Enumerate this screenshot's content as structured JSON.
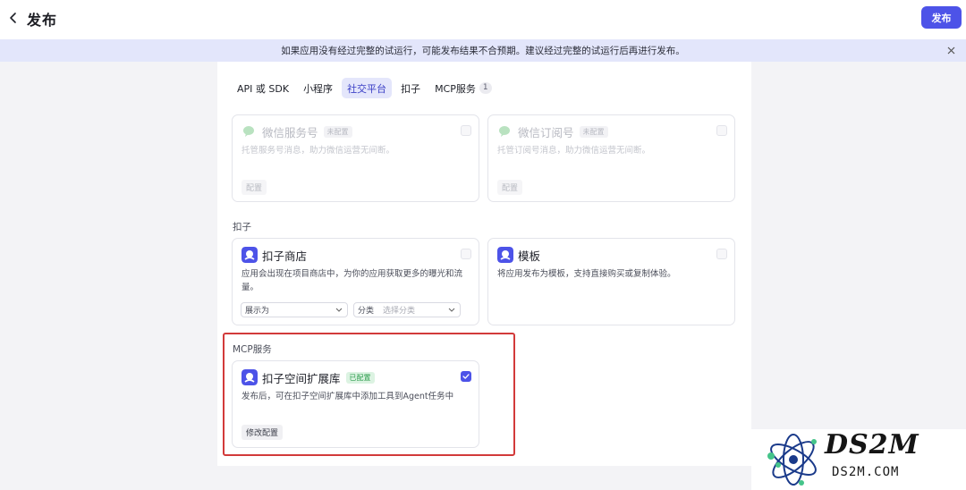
{
  "header": {
    "title": "发布",
    "publish_label": "发布"
  },
  "notice": {
    "text": "如果应用没有经过完整的试运行，可能发布结果不合预期。建议经过完整的试运行后再进行发布。"
  },
  "tabs": [
    {
      "label": "API 或 SDK",
      "active": false
    },
    {
      "label": "小程序",
      "active": false
    },
    {
      "label": "社交平台",
      "active": true
    },
    {
      "label": "扣子",
      "active": false
    },
    {
      "label": "MCP服务",
      "active": false,
      "badge": "1"
    }
  ],
  "social": {
    "wechat_service": {
      "title": "微信服务号",
      "badge": "未配置",
      "desc": "托管服务号消息，助力微信运营无间断。",
      "button": "配置"
    },
    "wechat_sub": {
      "title": "微信订阅号",
      "badge": "未配置",
      "desc": "托管订阅号消息，助力微信运营无间断。",
      "button": "配置"
    }
  },
  "kouzi": {
    "section_label": "扣子",
    "store": {
      "title": "扣子商店",
      "desc_line1": "应用会出现在项目商店中，为你的应用获取更多的曝光和流",
      "desc_line2": "量。",
      "display_select": "展示为",
      "category_label": "分类",
      "category_placeholder": "选择分类"
    },
    "template": {
      "title": "模板",
      "desc": "将应用发布为模板，支持直接购买或复制体验。"
    }
  },
  "mcp": {
    "section_label": "MCP服务",
    "card": {
      "title": "扣子空间扩展库",
      "badge": "已配置",
      "desc": "发布后，可在扣子空间扩展库中添加工具到Agent任务中",
      "button": "修改配置",
      "checked": true
    }
  },
  "watermark": {
    "line1": "DS2M",
    "line2": "DS2M.COM"
  },
  "colors": {
    "accent": "#4d53e8",
    "notice_bg": "#e3e6fb",
    "highlight": "#d23a3a",
    "wechat_green": "#9fd6a8"
  }
}
